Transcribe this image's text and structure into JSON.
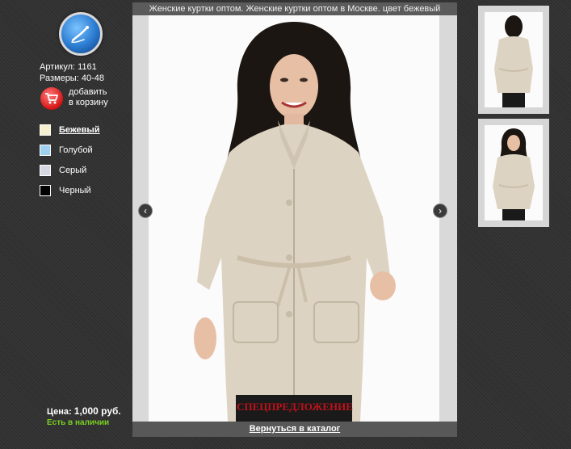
{
  "sidebar": {
    "logo_icon": "brush-logo-icon",
    "article": "Артикул: 1161",
    "sizes": "Размеры: 40-48",
    "cart_line1": "добавить",
    "cart_line2": "в корзину",
    "colors": [
      {
        "label": "Бежевый",
        "swatch": "#f6f0cf",
        "selected": true
      },
      {
        "label": "Голубой",
        "swatch": "#9fd0ef",
        "selected": false
      },
      {
        "label": "Серый",
        "swatch": "#d7d7e3",
        "selected": false
      },
      {
        "label": "Черный",
        "swatch": "#000000",
        "selected": false
      }
    ],
    "price_label": "Цена:",
    "price_value": "1,000 руб.",
    "stock": "Есть в наличии"
  },
  "viewer": {
    "title": "Женские куртки оптом. Женские куртки оптом в Москве. цвет бежевый",
    "prev_icon": "chevron-left-icon",
    "next_icon": "chevron-right-icon",
    "prev_glyph": "‹",
    "next_glyph": "›",
    "special": "СПЕЦПРЕДЛОЖЕНИЕ",
    "back_link": "Вернуться в каталог"
  },
  "colors_theme": {
    "background": "#2f2f2f",
    "stock_green": "#7ad122",
    "special_red": "#c0121a",
    "coat_beige": "#ddd3c2"
  }
}
